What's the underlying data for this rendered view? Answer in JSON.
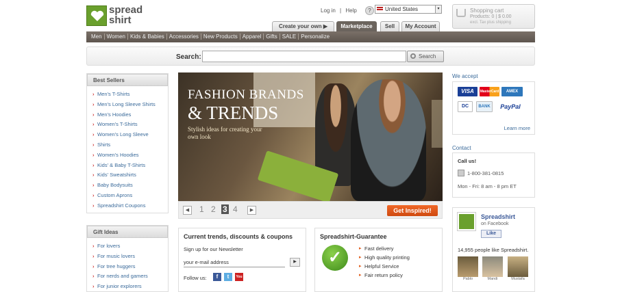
{
  "logo": {
    "line1": "spread",
    "line2": "shirt"
  },
  "top_links": {
    "login": "Log in",
    "separator": "|",
    "help": "Help",
    "help_icon": "?",
    "country": "United States",
    "dropdown_icon": "▾"
  },
  "cart": {
    "title": "Shopping cart",
    "info": "Products: 0 | $ 0.00",
    "shipping": "excl. Tax plus shipping"
  },
  "tabs": {
    "create": "Create your own",
    "create_icon": "▶",
    "marketplace": "Marketplace",
    "sell": "Sell",
    "account": "My Account"
  },
  "nav": [
    "Men",
    "Women",
    "Kids & Babies",
    "Accessories",
    "New Products",
    "Apparel",
    "Gifts",
    "SALE",
    "Personalize"
  ],
  "search": {
    "label": "Search:",
    "value": "",
    "button": "Search"
  },
  "best_sellers": {
    "title": "Best Sellers",
    "items": [
      "Men's T-Shirts",
      "Men's Long Sleeve Shirts",
      "Men's Hoodies",
      "Women's T-Shirts",
      "Women's Long Sleeve",
      "Shirts",
      "Women's Hoodies",
      "Kids' & Baby T-Shirts",
      "Kids' Sweatshirts",
      "Baby Bodysuits",
      "Custom Aprons",
      "Spreadshirt Coupons"
    ]
  },
  "gift_ideas": {
    "title": "Gift Ideas",
    "items": [
      "For lovers",
      "For music lovers",
      "For tree huggers",
      "For nerds and gamers",
      "For junior explorers"
    ]
  },
  "hero": {
    "title_line1": "FASHION BRANDS",
    "title_line2": "& TRENDS",
    "subtitle": "Stylish ideas for creating your own look",
    "prev": "◀",
    "next": "▶",
    "pages": [
      "1",
      "2",
      "3",
      "4"
    ],
    "active_page": "3",
    "cta": "Get Inspired!"
  },
  "trends": {
    "title": "Current trends, discounts & coupons",
    "newsletter_label": "Sign up for our Newsletter",
    "newsletter_value": "your e-mail address",
    "submit_icon": "▶",
    "follow_label": "Follow us:",
    "social": {
      "facebook": "f",
      "twitter": "t",
      "youtube": "You Tube"
    }
  },
  "guarantee": {
    "title": "Spreadshirt-Guarantee",
    "check_icon": "✓",
    "items": [
      "Fast delivery",
      "High quality printing",
      "Helpful Service",
      "Fair return policy"
    ]
  },
  "payment": {
    "title": "We accept",
    "cards": {
      "visa": "VISA",
      "mastercard": "MasterCard",
      "amex": "AMEX",
      "diners": "DC",
      "bank": "BANK",
      "paypal": "PayPal"
    },
    "learn_more": "Learn more"
  },
  "contact": {
    "title": "Contact",
    "callus": "Call us!",
    "phone": "1-800-381-0815",
    "hours": "Mon - Fri: 8 am - 8 pm ET"
  },
  "facebook": {
    "name": "Spreadshirt",
    "on": "on Facebook",
    "like": "Like",
    "count": "14,955 people like Spreadshirt.",
    "fans": [
      "Pablo",
      "Mandi",
      "Mustafa"
    ]
  },
  "colors": {
    "brand_green": "#6aa02d",
    "nav_brown": "#6b645d",
    "cta_orange": "#e25c1a",
    "link_blue": "#3a6a9a"
  }
}
